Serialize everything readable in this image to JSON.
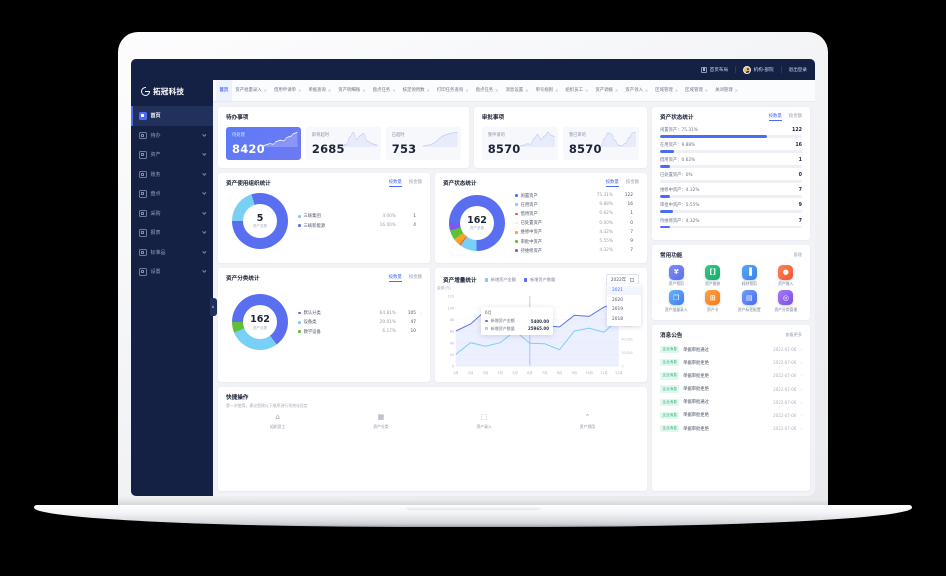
{
  "brand": {
    "name": "拓冠科技",
    "logo_icon": "g-circle-logo"
  },
  "topbar": {
    "items": [
      {
        "label": "首页布局",
        "icon": "layout-icon"
      },
      {
        "label": "机构-部院",
        "icon": "user-avatar"
      },
      {
        "label": "退出登录",
        "icon": "logout-icon"
      }
    ]
  },
  "tabs": [
    {
      "label": "首页",
      "active": true,
      "closable": false
    },
    {
      "label": "资产批量录入",
      "active": false,
      "closable": true
    },
    {
      "label": "借用申请单",
      "active": false,
      "closable": true
    },
    {
      "label": "单据查询",
      "active": false,
      "closable": true
    },
    {
      "label": "资产明细账",
      "active": false,
      "closable": true
    },
    {
      "label": "盘点任务",
      "active": false,
      "closable": true
    },
    {
      "label": "核定领用数",
      "active": false,
      "closable": true
    },
    {
      "label": "打印任务查询",
      "active": false,
      "closable": true
    },
    {
      "label": "盘点任务",
      "active": false,
      "closable": true
    },
    {
      "label": "消息设置",
      "active": false,
      "closable": true
    },
    {
      "label": "单号规则",
      "active": false,
      "closable": true
    },
    {
      "label": "组织员工",
      "active": false,
      "closable": true
    },
    {
      "label": "资产调拨",
      "active": false,
      "closable": true
    },
    {
      "label": "资产领入",
      "active": false,
      "closable": true
    },
    {
      "label": "区域管理",
      "active": false,
      "closable": true
    },
    {
      "label": "区域管理",
      "active": false,
      "closable": true
    },
    {
      "label": "关闭管理",
      "active": false,
      "closable": true
    }
  ],
  "sidebar": {
    "items": [
      {
        "label": "首页",
        "icon": "home-icon",
        "active": true,
        "expandable": false
      },
      {
        "label": "待办",
        "icon": "todo-icon",
        "active": false,
        "expandable": true
      },
      {
        "label": "资产",
        "icon": "assets-icon",
        "active": false,
        "expandable": true
      },
      {
        "label": "账务",
        "icon": "finance-icon",
        "active": false,
        "expandable": true
      },
      {
        "label": "盘点",
        "icon": "inventory-icon",
        "active": false,
        "expandable": true
      },
      {
        "label": "采购",
        "icon": "purchase-icon",
        "active": false,
        "expandable": true
      },
      {
        "label": "报表",
        "icon": "report-icon",
        "active": false,
        "expandable": true
      },
      {
        "label": "标准品",
        "icon": "standard-icon",
        "active": false,
        "expandable": true
      },
      {
        "label": "设置",
        "icon": "gear-icon",
        "active": false,
        "expandable": true
      }
    ],
    "collapse_icon": "chevron-left-icon"
  },
  "todo_card": {
    "title": "待办事项",
    "stats": [
      {
        "label": "待处理",
        "value": "8420",
        "primary": true
      },
      {
        "label": "即将超时",
        "value": "2685",
        "primary": false
      },
      {
        "label": "已超时",
        "value": "753",
        "primary": false
      }
    ]
  },
  "approval_card": {
    "title": "审批事项",
    "stats": [
      {
        "label": "我申请的",
        "value": "8570",
        "primary": false
      },
      {
        "label": "我已审的",
        "value": "8570",
        "primary": false
      }
    ]
  },
  "org_card": {
    "title": "资产使用组织统计",
    "toggle": [
      {
        "label": "按数量",
        "on": true
      },
      {
        "label": "按金额",
        "on": false
      }
    ],
    "center_value": "5",
    "center_label": "资产总数"
  },
  "status_card": {
    "title": "资产状态统计",
    "toggle": [
      {
        "label": "按数量",
        "on": true
      },
      {
        "label": "按金额",
        "on": false
      }
    ],
    "center_value": "162",
    "center_label": "资产总数"
  },
  "class_card": {
    "title": "资产分类统计",
    "toggle": [
      {
        "label": "按数量",
        "on": true
      },
      {
        "label": "按金额",
        "on": false
      }
    ],
    "center_value": "162",
    "center_label": "资产总数"
  },
  "status_panel": {
    "title": "资产状态统计",
    "toggle": [
      {
        "label": "按数量",
        "on": true
      },
      {
        "label": "按金额",
        "on": false
      }
    ]
  },
  "functions_card": {
    "title": "常用功能",
    "manage_label": "管理",
    "items": [
      {
        "label": "资产领用",
        "icon": "yuan-icon",
        "glyph": "¥",
        "color1": "#7b8cf9",
        "color2": "#5a6ff0"
      },
      {
        "label": "资产维修",
        "icon": "wrench-icon",
        "glyph": "[]",
        "color1": "#35c988",
        "color2": "#17a96a"
      },
      {
        "label": "耗材领用",
        "icon": "bar-chart-icon",
        "glyph": "▐",
        "color1": "#56a8f5",
        "color2": "#3a84e8"
      },
      {
        "label": "资产借入",
        "icon": "user-plus-icon",
        "glyph": "●",
        "color1": "#ff8358",
        "color2": "#f4552f"
      },
      {
        "label": "资产批量录入",
        "icon": "copy-icon",
        "glyph": "❐",
        "color1": "#6ab4f7",
        "color2": "#3f7ded"
      },
      {
        "label": "资产卡",
        "icon": "card-icon",
        "glyph": "⊞",
        "color1": "#ffa148",
        "color2": "#f27c16"
      },
      {
        "label": "资产标签配置",
        "icon": "tag-icon",
        "glyph": "▤",
        "color1": "#6f9df8",
        "color2": "#4a6cf7"
      },
      {
        "label": "资产分类管理",
        "icon": "folder-icon",
        "glyph": "◎",
        "color1": "#a47bf5",
        "color2": "#7b4fe8"
      }
    ]
  },
  "announce_card": {
    "title": "消息公告",
    "more_label": "查看更多",
    "items": [
      {
        "badge": "企业消息",
        "text": "单据审批通过",
        "date": "2022-07-06"
      },
      {
        "badge": "企业消息",
        "text": "单据审批拒绝",
        "date": "2022-07-06"
      },
      {
        "badge": "企业消息",
        "text": "单据审批拒绝",
        "date": "2022-07-06"
      },
      {
        "badge": "企业消息",
        "text": "单据审批拒绝",
        "date": "2022-07-06"
      },
      {
        "badge": "企业消息",
        "text": "单据审批通过",
        "date": "2022-07-06"
      },
      {
        "badge": "企业消息",
        "text": "单据审批拒绝",
        "date": "2022-07-06"
      },
      {
        "badge": "企业消息",
        "text": "单据审批拒绝",
        "date": "2022-07-06"
      }
    ]
  },
  "growth_card": {
    "title": "资产增量统计",
    "legend": [
      {
        "label": "新增资产金额",
        "color": "#79d0f7"
      },
      {
        "label": "新增资产数量",
        "color": "#5a6ff0"
      }
    ],
    "year_selected": "2022年",
    "year_options": [
      {
        "label": "2021",
        "selected": true
      },
      {
        "label": "2020",
        "selected": false
      },
      {
        "label": "2019",
        "selected": false
      },
      {
        "label": "2018",
        "selected": false
      }
    ],
    "tooltip": {
      "header": "6月",
      "rows": [
        {
          "label": "新增资产金额",
          "value": "5400.00"
        },
        {
          "label": "新增资产数量",
          "value": "25965.00"
        }
      ]
    }
  },
  "quick_card": {
    "title": "快捷操作",
    "subtitle": "第一次使用，建议您按以下顺序进行系统化设定",
    "items": [
      {
        "label": "组织员工",
        "icon": "org-icon"
      },
      {
        "label": "资产分类",
        "icon": "class-icon"
      },
      {
        "label": "资产录入",
        "icon": "entry-icon"
      },
      {
        "label": "资产领用",
        "icon": "receive-icon"
      }
    ]
  },
  "chart_data": [
    {
      "type": "pie",
      "title": "资产使用组织统计",
      "center_total": 5,
      "center_label": "资产总数",
      "unit_mode": "按数量",
      "slices": [
        {
          "name": "三峡集团",
          "percent": 4.0,
          "value": 1,
          "color": "#79d0f7"
        },
        {
          "name": "三峡新能源",
          "percent": 16.0,
          "value": 4,
          "color": "#5a6ff0"
        }
      ]
    },
    {
      "type": "pie",
      "title": "资产状态统计",
      "center_total": 162,
      "center_label": "资产总数",
      "unit_mode": "按数量",
      "slices": [
        {
          "name": "闲置资产",
          "percent": 75.31,
          "value": 122,
          "color": "#5a6ff0"
        },
        {
          "name": "在用资产",
          "percent": 9.88,
          "value": 16,
          "color": "#79d0f7"
        },
        {
          "name": "借用资产",
          "percent": 0.62,
          "value": 1,
          "color": "#f04a4a"
        },
        {
          "name": "已处置资产",
          "percent": 0.0,
          "value": 0,
          "color": "#e9ecf3"
        },
        {
          "name": "维修中资产",
          "percent": 4.32,
          "value": 7,
          "color": "#f5a623"
        },
        {
          "name": "审批中资产",
          "percent": 5.55,
          "value": 9,
          "color": "#60bf3a"
        },
        {
          "name": "待维修资产",
          "percent": 4.32,
          "value": 7,
          "color": "#7a5af0"
        }
      ]
    },
    {
      "type": "pie",
      "title": "资产分类统计",
      "center_total": 162,
      "center_label": "资产总数",
      "unit_mode": "按数量",
      "slices": [
        {
          "name": "默认分类",
          "percent": 64.81,
          "value": 105,
          "color": "#5a6ff0"
        },
        {
          "name": "设备类",
          "percent": 29.01,
          "value": 47,
          "color": "#79d0f7"
        },
        {
          "name": "教学设备",
          "percent": 6.17,
          "value": 10,
          "color": "#60bf3a"
        }
      ]
    },
    {
      "type": "bar",
      "title": "资产状态统计",
      "xlabel": "",
      "ylabel": "",
      "categories": [
        "闲置资产",
        "在用资产",
        "借用资产",
        "已处置资产",
        "维修中资产",
        "审批中资产",
        "待维修资产"
      ],
      "percent_labels": [
        "75.31%",
        "9.88%",
        "0.62%",
        "0%",
        "4.32%",
        "5.55%",
        "4.32%"
      ],
      "values": [
        122,
        16,
        1,
        0,
        7,
        9,
        7
      ],
      "bar_fill_percent": [
        75.31,
        9.88,
        7.0,
        0,
        7.0,
        9.0,
        7.0
      ],
      "color": "#4a6cf7"
    },
    {
      "type": "area",
      "title": "资产增量统计",
      "xlabel": "",
      "ylabel": "金额(元)",
      "categories": [
        "1月",
        "2月",
        "3月",
        "4月",
        "5月",
        "6月",
        "7月",
        "8月",
        "9月",
        "10月",
        "11月",
        "12月"
      ],
      "ylim": [
        0,
        120
      ],
      "yticks": [
        0,
        20,
        40,
        60,
        80,
        100,
        120
      ],
      "y2ticks": [
        "0",
        "20,000",
        "40,000",
        "60,000",
        "80,000"
      ],
      "grid": true,
      "legend_position": "top",
      "series": [
        {
          "name": "新增资产数量",
          "color": "#5a6ff0",
          "values": [
            60,
            72,
            95,
            80,
            71,
            68,
            69,
            67,
            87,
            85,
            101,
            110
          ]
        },
        {
          "name": "新增资产金额",
          "color": "#79d0f7",
          "values": [
            20,
            40,
            34,
            40,
            60,
            39,
            38,
            28,
            60,
            65,
            58,
            80
          ]
        }
      ],
      "annotation": {
        "at": "6月",
        "values": {
          "新增资产金额": "5400.00",
          "新增资产数量": "25965.00"
        }
      }
    },
    {
      "type": "line",
      "title": "待处理",
      "values": [
        14,
        18,
        22,
        20,
        30,
        34,
        32,
        44,
        48,
        58,
        62
      ],
      "color": "#ffffff"
    },
    {
      "type": "line",
      "title": "即将超时",
      "values": [
        8,
        14,
        40,
        56,
        30,
        44,
        52,
        26,
        18,
        14,
        10
      ],
      "color": "#b9c3f5"
    },
    {
      "type": "line",
      "title": "已超时",
      "values": [
        6,
        8,
        10,
        16,
        26,
        40,
        48,
        54,
        58,
        60,
        62
      ],
      "color": "#b9c3f5"
    },
    {
      "type": "line",
      "title": "我申请的",
      "values": [
        10,
        12,
        18,
        16,
        36,
        52,
        34,
        46,
        60,
        48,
        44
      ],
      "color": "#b9c3f5"
    },
    {
      "type": "line",
      "title": "我已审的",
      "values": [
        18,
        40,
        56,
        52,
        34,
        20,
        18,
        26,
        42,
        56,
        58
      ],
      "color": "#b9c3f5"
    }
  ]
}
